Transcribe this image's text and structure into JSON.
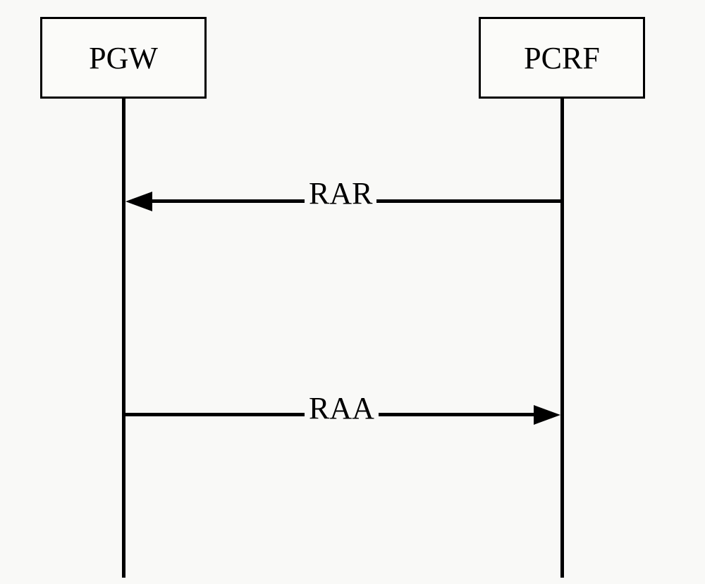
{
  "actors": {
    "left": {
      "label": "PGW"
    },
    "right": {
      "label": "PCRF"
    }
  },
  "messages": {
    "rar": {
      "label": "RAR"
    },
    "raa": {
      "label": "RAA"
    }
  }
}
